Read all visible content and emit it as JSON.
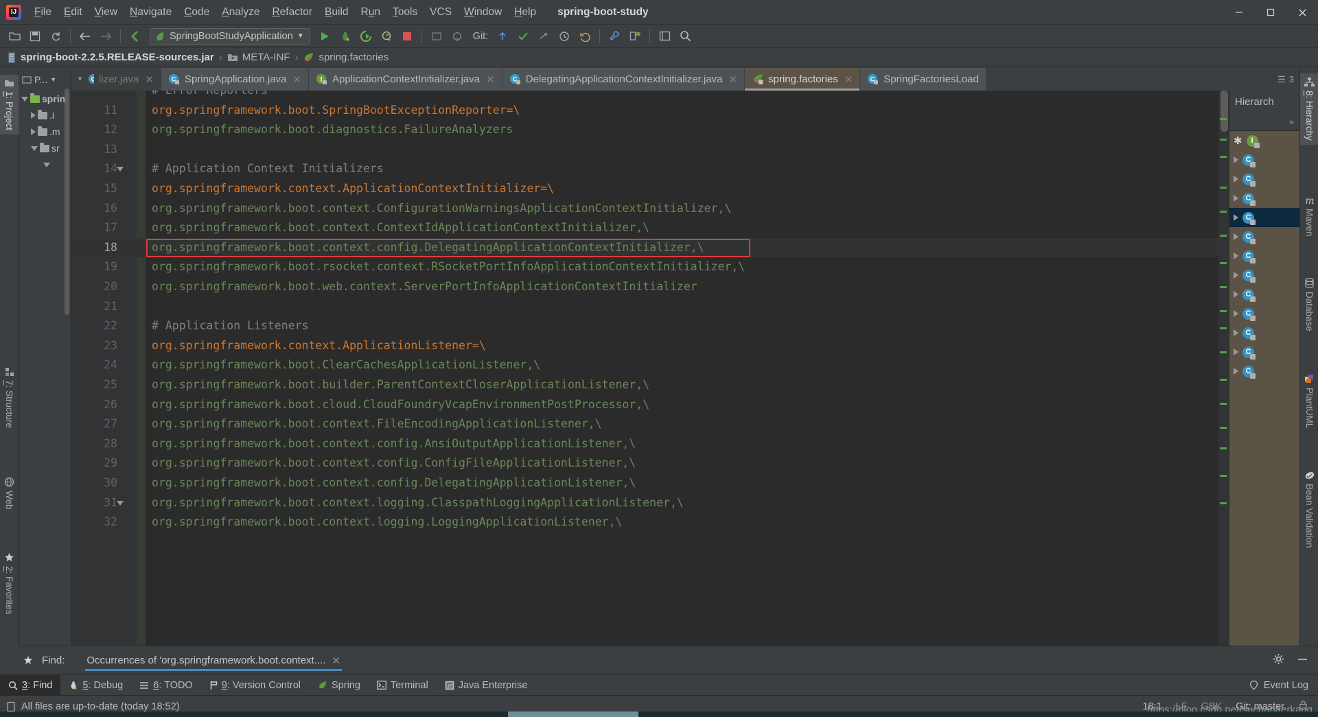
{
  "titlebar": {
    "menus": [
      "File",
      "Edit",
      "View",
      "Navigate",
      "Code",
      "Analyze",
      "Refactor",
      "Build",
      "Run",
      "Tools",
      "VCS",
      "Window",
      "Help"
    ],
    "window_title": "spring-boot-study",
    "logo_text": "IJ",
    "controls": {
      "minimize": "minimize-icon",
      "maximize": "maximize-icon",
      "close": "close-icon"
    }
  },
  "toolbar": {
    "run_config": "SpringBootStudyApplication",
    "git_label": "Git:",
    "icons": [
      "open-folder-icon",
      "save-all-icon",
      "sync-icon",
      "back-arrow-icon",
      "forward-arrow-icon",
      "flash-icon",
      "run-icon",
      "debug-icon",
      "run-coverage-icon",
      "profile-icon",
      "stop-icon",
      "build-icon",
      "build-module-icon",
      "git-update-icon",
      "git-commit-icon",
      "git-push-icon",
      "git-history-icon",
      "git-rollback-icon",
      "settings-wrench-icon",
      "project-structure-icon",
      "window-layout-icon",
      "search-everywhere-icon"
    ]
  },
  "breadcrumb": {
    "items": [
      {
        "label": "spring-boot-2.2.5.RELEASE-sources.jar",
        "icon": "jar-icon",
        "bold": true
      },
      {
        "label": "META-INF",
        "icon": "folder-icon",
        "bold": false
      },
      {
        "label": "spring.factories",
        "icon": "spring-leaf-icon",
        "bold": false
      }
    ],
    "separator": "›"
  },
  "left_rail": {
    "items": [
      {
        "label": "1: Project",
        "icon": "project-folder-icon",
        "active": true
      },
      {
        "label": "7: Structure",
        "icon": "structure-icon",
        "active": false
      },
      {
        "label": "Web",
        "icon": "web-globe-icon",
        "active": false
      },
      {
        "label": "2: Favorites",
        "icon": "favorites-star-icon",
        "active": false
      }
    ]
  },
  "right_rail": {
    "items": [
      {
        "label": "8: Hierarchy",
        "icon": "hierarchy-icon",
        "active": true
      },
      {
        "label": "Maven",
        "icon": "maven-m-icon",
        "active": false
      },
      {
        "label": "Database",
        "icon": "database-icon",
        "active": false
      },
      {
        "label": "PlantUML",
        "icon": "plantuml-icon",
        "active": false
      },
      {
        "label": "Bean Validation",
        "icon": "bean-validation-icon",
        "active": false
      }
    ]
  },
  "project_panel": {
    "title": "P...",
    "nodes": [
      {
        "label": "sprin",
        "icon": "module-icon",
        "expanded": true
      },
      {
        "label": ".i",
        "icon": "folder-icon",
        "expanded": false
      },
      {
        "label": ".m",
        "icon": "folder-icon",
        "expanded": false
      },
      {
        "label": "sr",
        "icon": "folder-icon",
        "expanded": true
      }
    ]
  },
  "tabs": [
    {
      "label": "lizer.java",
      "icon": "class-icon",
      "active": false,
      "truncated": true,
      "closable": true
    },
    {
      "label": "SpringApplication.java",
      "icon": "class-icon",
      "active": false,
      "closable": true
    },
    {
      "label": "ApplicationContextInitializer.java",
      "icon": "interface-icon",
      "active": false,
      "closable": true
    },
    {
      "label": "DelegatingApplicationContextInitializer.java",
      "icon": "class-icon",
      "active": false,
      "closable": true
    },
    {
      "label": "spring.factories",
      "icon": "spring-leaf-icon",
      "active": true,
      "closable": true
    },
    {
      "label": "SpringFactoriesLoad",
      "icon": "class-icon",
      "active": false,
      "closable": false
    }
  ],
  "editor": {
    "first_line_number": 11,
    "current_line": 18,
    "lines": [
      {
        "n": 10,
        "text": "# Error Reporters",
        "type": "comment",
        "partial": true
      },
      {
        "n": 11,
        "text": "org.springframework.boot.SpringBootExceptionReporter=\\",
        "type": "key"
      },
      {
        "n": 12,
        "text": "org.springframework.boot.diagnostics.FailureAnalyzers",
        "type": "value"
      },
      {
        "n": 13,
        "text": "",
        "type": "blank"
      },
      {
        "n": 14,
        "text": "# Application Context Initializers",
        "type": "comment"
      },
      {
        "n": 15,
        "text": "org.springframework.context.ApplicationContextInitializer=\\",
        "type": "key"
      },
      {
        "n": 16,
        "text": "org.springframework.boot.context.ConfigurationWarningsApplicationContextInitializer,\\",
        "type": "value"
      },
      {
        "n": 17,
        "text": "org.springframework.boot.context.ContextIdApplicationContextInitializer,\\",
        "type": "value"
      },
      {
        "n": 18,
        "text": "org.springframework.boot.context.config.DelegatingApplicationContextInitializer,\\",
        "type": "value",
        "highlighted": true
      },
      {
        "n": 19,
        "text": "org.springframework.boot.rsocket.context.RSocketPortInfoApplicationContextInitializer,\\",
        "type": "value"
      },
      {
        "n": 20,
        "text": "org.springframework.boot.web.context.ServerPortInfoApplicationContextInitializer",
        "type": "value"
      },
      {
        "n": 21,
        "text": "",
        "type": "blank"
      },
      {
        "n": 22,
        "text": "# Application Listeners",
        "type": "comment"
      },
      {
        "n": 23,
        "text": "org.springframework.context.ApplicationListener=\\",
        "type": "key"
      },
      {
        "n": 24,
        "text": "org.springframework.boot.ClearCachesApplicationListener,\\",
        "type": "value"
      },
      {
        "n": 25,
        "text": "org.springframework.boot.builder.ParentContextCloserApplicationListener,\\",
        "type": "value"
      },
      {
        "n": 26,
        "text": "org.springframework.boot.cloud.CloudFoundryVcapEnvironmentPostProcessor,\\",
        "type": "value"
      },
      {
        "n": 27,
        "text": "org.springframework.boot.context.FileEncodingApplicationListener,\\",
        "type": "value"
      },
      {
        "n": 28,
        "text": "org.springframework.boot.context.config.AnsiOutputApplicationListener,\\",
        "type": "value"
      },
      {
        "n": 29,
        "text": "org.springframework.boot.context.config.ConfigFileApplicationListener,\\",
        "type": "value"
      },
      {
        "n": 30,
        "text": "org.springframework.boot.context.config.DelegatingApplicationListener,\\",
        "type": "value"
      },
      {
        "n": 31,
        "text": "org.springframework.boot.context.logging.ClasspathLoggingApplicationListener,\\",
        "type": "value"
      },
      {
        "n": 32,
        "text": "org.springframework.boot.context.logging.LoggingApplicationListener,\\",
        "type": "value",
        "partial": true
      }
    ],
    "highlight_color": "#e03b3b"
  },
  "hierarchy_panel": {
    "title": "Hierarch",
    "overflow_label": "»",
    "rows": [
      {
        "icon": "interface-icon",
        "selected": false,
        "star": true
      },
      {
        "icon": "class-icon",
        "selected": false
      },
      {
        "icon": "class-icon",
        "selected": false
      },
      {
        "icon": "class-icon",
        "selected": false
      },
      {
        "icon": "class-icon",
        "selected": true
      },
      {
        "icon": "class-icon",
        "selected": false
      },
      {
        "icon": "class-icon",
        "selected": false
      },
      {
        "icon": "class-icon",
        "selected": false
      },
      {
        "icon": "class-icon",
        "selected": false
      },
      {
        "icon": "class-icon",
        "selected": false
      },
      {
        "icon": "class-icon",
        "selected": false
      },
      {
        "icon": "class-icon",
        "selected": false
      },
      {
        "icon": "class-icon",
        "selected": false
      }
    ]
  },
  "findbar": {
    "label": "Find:",
    "tab_title": "Occurrences of 'org.springframework.boot.context....",
    "close_icon": "close-icon",
    "star_icon": "pin-star-icon",
    "gear_icon": "gear-icon",
    "minimize_icon": "minimize-icon"
  },
  "bottom_tabs": [
    {
      "label": "3: Find",
      "icon": "search-icon",
      "active": true
    },
    {
      "label": "5: Debug",
      "icon": "debug-bug-icon",
      "active": false
    },
    {
      "label": "6: TODO",
      "icon": "todo-list-icon",
      "active": false
    },
    {
      "label": "9: Version Control",
      "icon": "branch-icon",
      "active": false
    },
    {
      "label": "Spring",
      "icon": "spring-leaf-icon",
      "active": false
    },
    {
      "label": "Terminal",
      "icon": "terminal-icon",
      "active": false
    },
    {
      "label": "Java Enterprise",
      "icon": "java-enterprise-icon",
      "active": false
    }
  ],
  "bottom_right": {
    "event_log": "Event Log",
    "event_log_icon": "event-log-icon"
  },
  "statusbar": {
    "message": "All files are up-to-date (today 18:52)",
    "message_icon": "document-icon",
    "caret_position": "18:1",
    "line_separator": "LF",
    "encoding": "GBK",
    "branch": "Git: master",
    "branch_icon": "git-branch-icon",
    "lock_icon": "read-only-icon"
  },
  "watermark": "https://blog.csdn.net/suchanaerkang",
  "colors": {
    "background": "#3c3f41",
    "editor_bg": "#2b2b2b",
    "accent_blue": "#4a88c7",
    "active_tab": "#5b5345",
    "comment": "#808080",
    "key": "#cc7832",
    "value": "#6a8759",
    "highlight_border": "#e03b3b"
  }
}
